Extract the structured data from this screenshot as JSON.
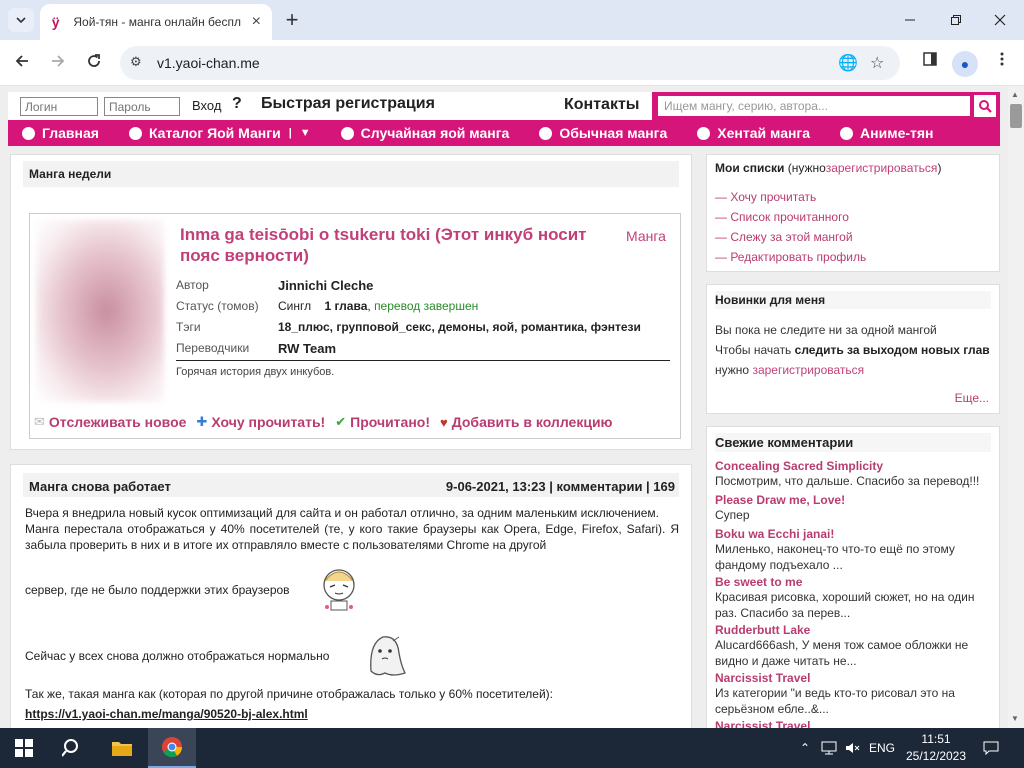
{
  "browser": {
    "tab_title": "Яой-тян - манга онлайн беспл",
    "url": "v1.yaoi-chan.me"
  },
  "site": {
    "login_placeholder": "Логин",
    "password_placeholder": "Пароль",
    "login_button": "Вход",
    "help": "?",
    "quick_register": "Быстрая регистрация",
    "contacts": "Контакты",
    "search_placeholder": "Ищем мангу, серию, автора...",
    "menu": [
      {
        "label": "Главная"
      },
      {
        "label": "Каталог Яой Манги"
      },
      {
        "label": "Случайная яой манга"
      },
      {
        "label": "Обычная манга"
      },
      {
        "label": "Хентай манга"
      },
      {
        "label": "Аниме-тян"
      }
    ],
    "catalog_divider": "|"
  },
  "manga_week": {
    "section_title": "Манга недели",
    "title": "Inma ga teisōobi o tsukeru toki (Этот инкуб носит пояс верности)",
    "type": "Манга",
    "author_label": "Автор",
    "author": "Jinnichi Cleche",
    "status_label": "Статус (томов)",
    "status_single": "Сингл",
    "status_chapters": "1 глава",
    "status_comma": ",",
    "status_done": "перевод завершен",
    "tags_label": "Тэги",
    "tags": "18_плюс, групповой_секс, демоны, яой, романтика, фэнтези",
    "translators_label": "Переводчики",
    "translators": "RW Team",
    "description": "Горячая история двух инкубов.",
    "actions": {
      "track": "Отслеживать новое",
      "want": "Хочу прочитать!",
      "read": "Прочитано!",
      "collection": "Добавить в коллекцию"
    }
  },
  "news": {
    "title": "Манга снова работает",
    "meta": "9-06-2021, 13:23 | комментарии | 169",
    "paragraph1": "Вчера я внедрила новый кусок оптимизаций для сайта и он работал отлично, за одним маленьким исключением.",
    "paragraph2": "Манга перестала отображаться у 40% посетителей (те, у кого такие браузеры как Opera, Edge, Firefox, Safari). Я забыла проверить в них и в итоге их отправляло вместе с пользователями Chrome на другой",
    "line3": "сервер, где не было поддержки этих браузеров",
    "line4": "Сейчас у всех снова должно отображаться нормально",
    "line5": "Так же, такая манга как (которая по другой причине отображалась только у 60% посетителей):",
    "link": "https://v1.yaoi-chan.me/manga/90520-bj-alex.html"
  },
  "sidebar": {
    "lists": {
      "title": "Мои списки",
      "note_open": "(нужно",
      "register": "зарегистрироваться",
      "note_close": ")",
      "items": [
        "— Хочу прочитать",
        "— Список прочитанного",
        "— Слежу за этой мангой",
        "— Редактировать профиль"
      ]
    },
    "new_for_me": {
      "title": "Новинки для меня",
      "line1": "Вы пока не следите ни за одной мангой",
      "line2_a": "Чтобы начать",
      "line2_b": "следить за выходом новых глав",
      "line3_a": "нужно",
      "line3_b": "зарегистрироваться",
      "more": "Еще..."
    },
    "comments": {
      "title": "Свежие комментарии",
      "items": [
        {
          "manga": "Concealing Sacred Simplicity",
          "text": "Посмотрим, что дальше. Спасибо за перевод!!!"
        },
        {
          "manga": "Please Draw me, Love!",
          "text": "Супер"
        },
        {
          "manga": "Boku wa Ecchi janai!",
          "text": "Миленько, наконец-то что-то ещё по этому фандому подъехало ..."
        },
        {
          "manga": "Be sweet to me",
          "text": "Красивая рисовка, хороший сюжет, но на один раз. Спасибо за перев..."
        },
        {
          "manga": "Rudderbutt Lake",
          "text": "Alucard666ash, У меня тож самое обложки не видно и даже читать не..."
        },
        {
          "manga": "Narcissist Travel",
          "text": "Из категории \"и ведь кто-то рисовал это на серьёзном ебле..&..."
        },
        {
          "manga": "Narcissist Travel",
          "text": ""
        }
      ]
    }
  },
  "taskbar": {
    "lang": "ENG",
    "time": "11:51",
    "date": "25/12/2023"
  },
  "colors": {
    "brand": "#d6157a",
    "link": "#b83c70",
    "success": "#2a8a2a"
  }
}
